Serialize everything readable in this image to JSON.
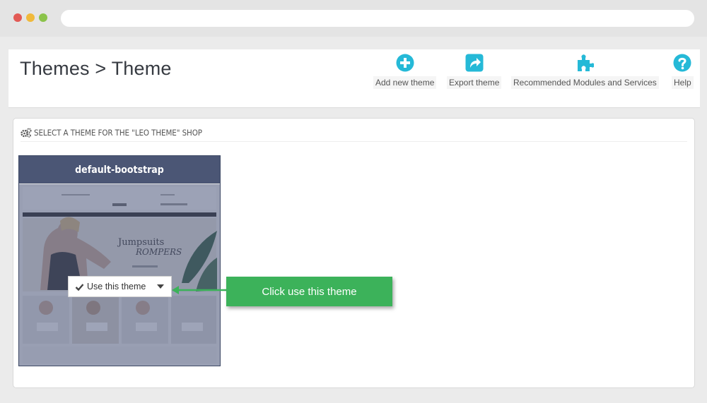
{
  "page": {
    "title": "Themes > Theme"
  },
  "toolbar": {
    "add_new_theme": {
      "label": "Add new theme",
      "icon": "plus-circle-icon"
    },
    "export_theme": {
      "label": "Export theme",
      "icon": "share-icon"
    },
    "recommended": {
      "label": "Recommended Modules and Services",
      "icon": "puzzle-icon"
    },
    "help": {
      "label": "Help",
      "icon": "question-circle-icon"
    }
  },
  "panel": {
    "heading": "SELECT A THEME FOR THE \"LEO THEME\" SHOP"
  },
  "theme_card": {
    "name": "default-bootstrap",
    "use_button_label": "Use this theme"
  },
  "callout": {
    "text": "Click use this theme"
  },
  "colors": {
    "accent_blue": "#25b9d7",
    "card_header": "#4b5675",
    "callout_green": "#3cb25a"
  }
}
